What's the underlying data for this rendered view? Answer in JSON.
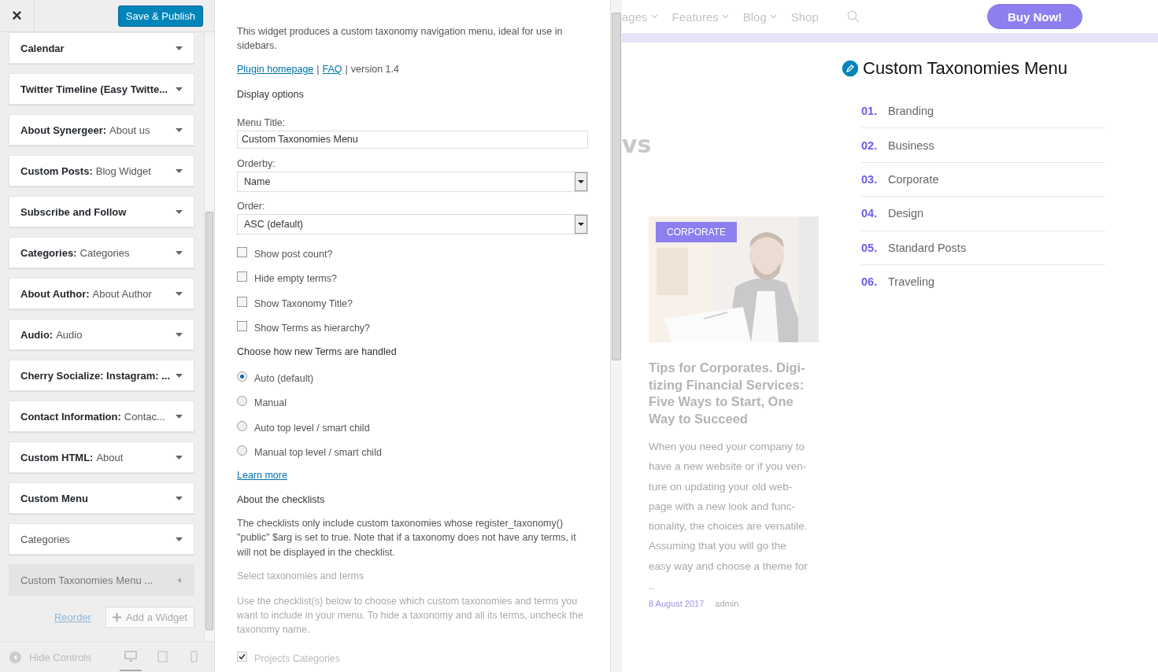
{
  "sidebar": {
    "close_label": "×",
    "publish_button": "Save & Publish",
    "widgets": [
      {
        "title": "Calendar",
        "expanded": false
      },
      {
        "title": "Twitter Timeline (Easy Twitte...",
        "expanded": false
      },
      {
        "title": "About Synergeer:",
        "subtitle": "About us",
        "expanded": false
      },
      {
        "title": "Custom Posts:",
        "subtitle": "Blog Widget",
        "expanded": false
      },
      {
        "title": "Subscribe and Follow",
        "expanded": false
      },
      {
        "title": "Categories:",
        "subtitle": "Categories",
        "expanded": false
      },
      {
        "title": "About Author:",
        "subtitle": "About Author",
        "expanded": false
      },
      {
        "title": "Audio:",
        "subtitle": "Audio",
        "expanded": false
      },
      {
        "title": "Cherry Socialize: Instagram: ...",
        "expanded": false
      },
      {
        "title": "Contact Information:",
        "subtitle": "Contac...",
        "expanded": false
      },
      {
        "title": "Custom HTML:",
        "subtitle": "About",
        "expanded": false
      },
      {
        "title": "Custom Menu",
        "expanded": false
      },
      {
        "subtitle": "Categories",
        "expanded": false
      },
      {
        "subtitle": "Custom Taxonomies Menu ...",
        "expanded": true
      }
    ],
    "reorder_link": "Reorder",
    "add_widget_button": "Add a Widget",
    "hide_controls": "Hide Controls",
    "devices": [
      {
        "kind": "desktop",
        "selected": true
      },
      {
        "kind": "tablet",
        "selected": false
      },
      {
        "kind": "mobile",
        "selected": false
      }
    ]
  },
  "form": {
    "intro": "This widget produces a custom taxonomy navigation menu, ideal for use in sidebars.",
    "links": [
      "Plugin homepage",
      "FAQ"
    ],
    "separators": [
      "|",
      "|"
    ],
    "version": "version 1.4",
    "display_heading": "Display options",
    "menu_title": {
      "label": "Menu Title:",
      "value": "Custom Taxonomies Menu"
    },
    "selects": [
      {
        "label": "Orderby:",
        "value": "Name"
      },
      {
        "label": "Order:",
        "value": "ASC (default)"
      }
    ],
    "checkboxes": [
      {
        "label": "Show post count?",
        "checked": false
      },
      {
        "label": "Hide empty terms?",
        "checked": false
      },
      {
        "label": "Show Taxonomy Title?",
        "checked": false
      },
      {
        "label": "Show Terms as hierarchy?",
        "checked": false
      }
    ],
    "terms_heading": "Choose how new Terms are handled",
    "radios": [
      {
        "label": "Auto (default)",
        "selected": true
      },
      {
        "label": "Manual",
        "selected": false
      },
      {
        "label": "Auto top level / smart child",
        "selected": false
      },
      {
        "label": "Manual top level / smart child",
        "selected": false
      }
    ],
    "learn_more": "Learn more",
    "checklists_heading": "About the checklists",
    "checklists_text": "The checklists only include custom taxonomies whose register_taxonomy() \"public\" $arg is set to true. Note that if a taxonomy does not have any terms, it will not be displayed in the checklist.",
    "select_heading": "Select taxonomies and terms",
    "select_text": "Use the checklist(s) below to choose which custom taxonomies and terms you want to include in your menu. To hide a taxonomy and all its terms, uncheck the taxonomy name.",
    "taxonomy_checks": [
      {
        "label": "Projects Categories",
        "checked": true
      }
    ]
  },
  "preview": {
    "nav": [
      "ages",
      "Features",
      "Blog",
      "Shop"
    ],
    "buy_button": "Buy Now!",
    "heading_fragment": "vs",
    "post": {
      "tag": "CORPORATE",
      "title_lines": [
        "Tips for Corporates. Digi-",
        "tizing Financial Services:",
        "Five Ways to Start, One",
        "Way to Succeed"
      ],
      "excerpt_lines": [
        "When you need your company to",
        "have a new website or if you ven-",
        "ture on updating your old web-",
        "page with a new look and func-",
        "tionality, the choices are versatile.",
        "Assuming that you will go the",
        "easy way and choose a theme for",
        ".."
      ],
      "date": "8 August 2017",
      "author": "admin"
    },
    "widget_title": "Custom Taxonomies Menu",
    "menu": [
      {
        "number": "01.",
        "label": "Branding"
      },
      {
        "number": "02.",
        "label": "Business"
      },
      {
        "number": "03.",
        "label": "Corporate"
      },
      {
        "number": "04.",
        "label": "Design"
      },
      {
        "number": "05.",
        "label": "Standard Posts"
      },
      {
        "number": "06.",
        "label": "Traveling"
      }
    ]
  }
}
